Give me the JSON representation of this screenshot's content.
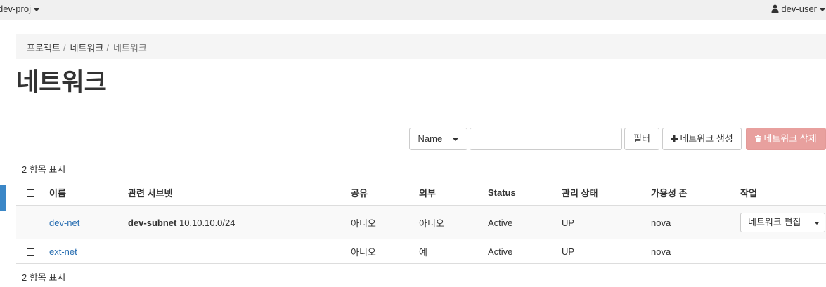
{
  "topbar": {
    "project": "dev-proj",
    "user": "dev-user",
    "user_icon": "user-icon"
  },
  "breadcrumb": {
    "items": [
      "프로젝트",
      "네트워크",
      "네트워크"
    ],
    "separator": "/"
  },
  "page": {
    "title": "네트워크"
  },
  "toolbar": {
    "filter_field": "Name =",
    "filter_value": "",
    "filter_button": "필터",
    "create_button": "네트워크 생성",
    "create_icon": "plus-icon",
    "delete_button": "네트워크 삭제",
    "delete_icon": "trash-icon"
  },
  "table": {
    "count_label": "2 항목 표시",
    "columns": [
      "이름",
      "관련 서브넷",
      "공유",
      "외부",
      "Status",
      "관리 상태",
      "가용성 존",
      "작업"
    ],
    "rows": [
      {
        "name": "dev-net",
        "subnet_name": "dev-subnet",
        "subnet_cidr": "10.10.10.0/24",
        "shared": "아니오",
        "external": "아니오",
        "status": "Active",
        "admin_state": "UP",
        "availability_zone": "nova",
        "action": "네트워크 편집"
      },
      {
        "name": "ext-net",
        "subnet_name": "",
        "subnet_cidr": "",
        "shared": "아니오",
        "external": "예",
        "status": "Active",
        "admin_state": "UP",
        "availability_zone": "nova",
        "action": ""
      }
    ]
  },
  "colors": {
    "link": "#2a6fb2",
    "danger_disabled": "#e8a09e",
    "topbar_bg": "#f0f0f0",
    "breadcrumb_bg": "#f5f5f5"
  }
}
